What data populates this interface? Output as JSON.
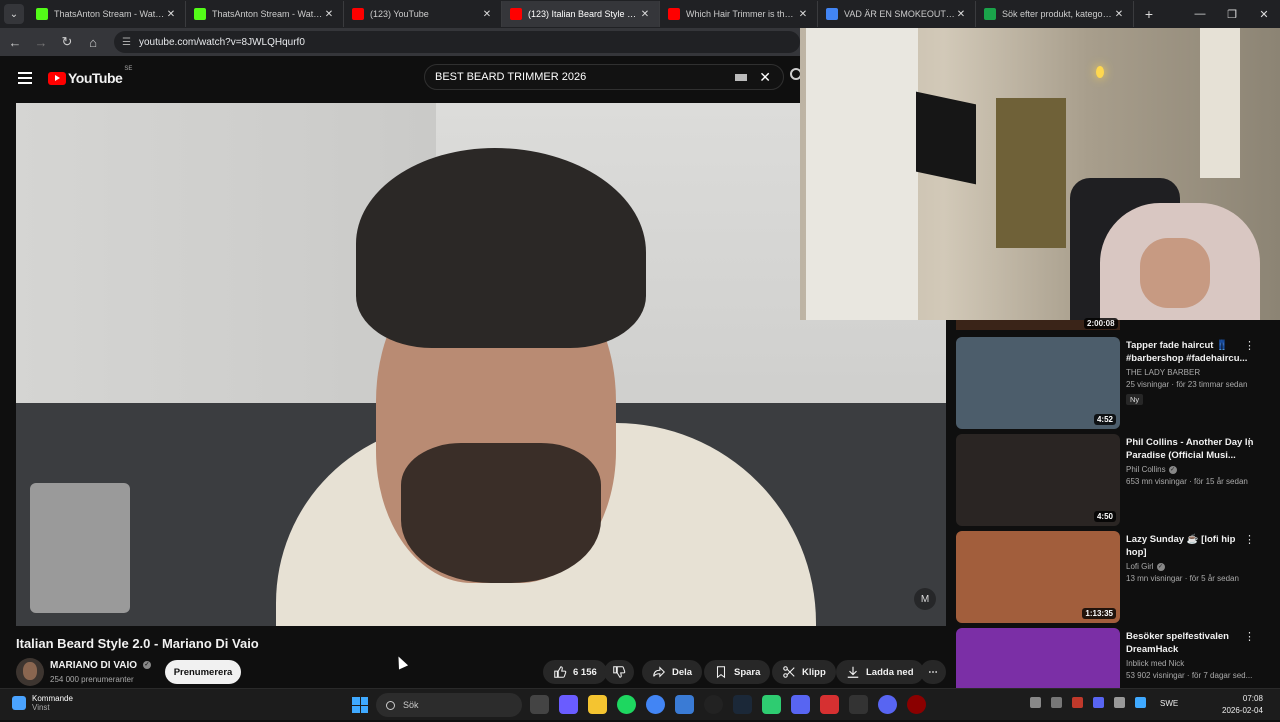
{
  "browser": {
    "tabs": [
      {
        "title": "ThatsAnton Stream - Watch Live",
        "fav": "#53fc18"
      },
      {
        "title": "ThatsAnton Stream - Watch Live",
        "fav": "#53fc18"
      },
      {
        "title": "(123) YouTube",
        "fav": "#ff0000"
      },
      {
        "title": "(123) Italian Beard Style 2.0",
        "fav": "#ff0000",
        "active": true
      },
      {
        "title": "Which Hair Trimmer is the KING",
        "fav": "#ff0000"
      },
      {
        "title": "VAD ÄR EN SMOKEOUT - Google",
        "fav": "#4285f4"
      },
      {
        "title": "Sök efter produkt, kategori eller",
        "fav": "#1aa34a"
      }
    ],
    "url": "youtube.com/watch?v=8JWLQHqurf0"
  },
  "youtube": {
    "logo_text": "YouTube",
    "region": "SE",
    "search_query": "BEST BEARD TRIMMER 2026"
  },
  "video": {
    "title": "Italian Beard Style 2.0 - Mariano Di Vaio",
    "channel": "MARIANO DI VAIO",
    "subscribers": "254 000 prenumeranter",
    "subscribe_label": "Prenumerera",
    "likes": "6 156",
    "share_label": "Dela",
    "save_label": "Spara",
    "clip_label": "Klipp",
    "download_label": "Ladda ned"
  },
  "recommendations": {
    "prev_duration": "2:00:08",
    "items": [
      {
        "title": "Tapper fade haircut 👖 #barbershop #fadehaircu...",
        "channel": "THE LADY BARBER",
        "stats": "25 visningar · för 23 timmar sedan",
        "duration": "4:52",
        "badge": "Ny",
        "verified": false,
        "thumb": "#4c5d6b"
      },
      {
        "title": "Phil Collins - Another Day In Paradise (Official Musi...",
        "channel": "Phil Collins",
        "stats": "653 mn visningar · för 15 år sedan",
        "duration": "4:50",
        "badge": "",
        "verified": true,
        "thumb": "#2a2523"
      },
      {
        "title": "Lazy Sunday ☕ [lofi hip hop]",
        "channel": "Lofi Girl",
        "stats": "13 mn visningar · för 5 år sedan",
        "duration": "1:13:35",
        "badge": "",
        "verified": true,
        "thumb": "#a25e3c"
      },
      {
        "title": "Besöker spelfestivalen DreamHack",
        "channel": "Inblick med Nick",
        "stats": "53 902 visningar · för 7 dagar sed...",
        "duration": "",
        "badge": "",
        "verified": false,
        "thumb": "#7b2fa6"
      }
    ]
  },
  "taskbar": {
    "weather_title": "Kommande",
    "weather_sub": "Vinst",
    "search_placeholder": "Sök",
    "lang": "SWE",
    "time": "07:08",
    "date": "2026-02-04"
  }
}
